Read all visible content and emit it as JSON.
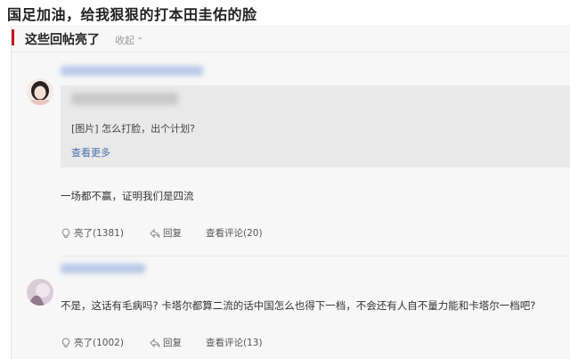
{
  "page": {
    "title": "国足加油，给我狠狠的打本田圭佑的脸"
  },
  "section": {
    "title": "这些回帖亮了",
    "collapse_label": "收起"
  },
  "posts": [
    {
      "quote": {
        "text": "[图片] 怎么打脸，出个计划?",
        "more_label": "查看更多"
      },
      "text": "一场都不赢，证明我们是四流",
      "actions": {
        "like": "亮了(1381)",
        "reply": "回复",
        "comments": "查看评论(20)"
      }
    },
    {
      "text": "不是，这话有毛病吗? 卡塔尔都算二流的话中国怎么也得下一档，不会还有人自不量力能和卡塔尔一档吧?",
      "actions": {
        "like": "亮了(1002)",
        "reply": "回复",
        "comments": "查看评论(13)"
      }
    }
  ],
  "colors": {
    "accent": "#c8161d",
    "link": "#4a6fa8"
  }
}
